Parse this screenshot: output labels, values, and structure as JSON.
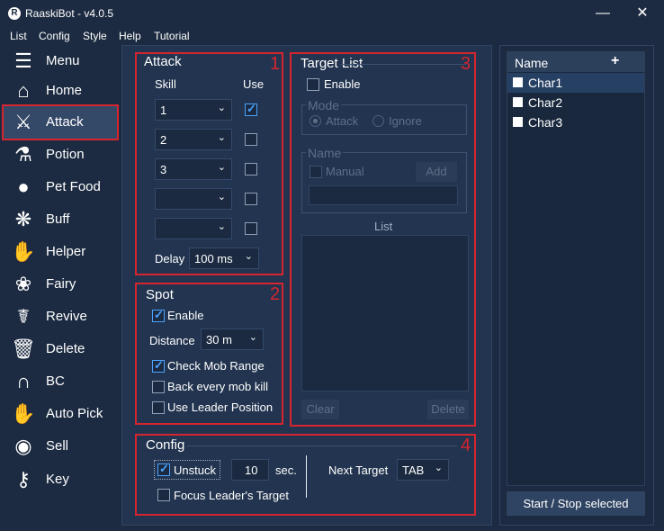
{
  "window": {
    "title": "RaaskiBot - v4.0.5",
    "minimize_icon": "minimize-icon",
    "close_icon": "close-icon"
  },
  "menu": [
    "List",
    "Config",
    "Style",
    "Help",
    "Tutorial"
  ],
  "sidebar": [
    {
      "label": "Menu",
      "icon": "hamburger-icon"
    },
    {
      "label": "Home",
      "icon": "home-icon"
    },
    {
      "label": "Attack",
      "icon": "sword-icon"
    },
    {
      "label": "Potion",
      "icon": "potion-icon"
    },
    {
      "label": "Pet Food",
      "icon": "pet-food-icon"
    },
    {
      "label": "Buff",
      "icon": "buff-icon"
    },
    {
      "label": "Helper",
      "icon": "handshake-icon"
    },
    {
      "label": "Fairy",
      "icon": "fairy-icon"
    },
    {
      "label": "Revive",
      "icon": "revive-icon"
    },
    {
      "label": "Delete",
      "icon": "trash-icon"
    },
    {
      "label": "BC",
      "icon": "bc-icon"
    },
    {
      "label": "Auto Pick",
      "icon": "auto-pick-icon"
    },
    {
      "label": "Sell",
      "icon": "coins-icon"
    },
    {
      "label": "Key",
      "icon": "key-icon"
    }
  ],
  "attack": {
    "title": "Attack",
    "number": "1",
    "skill_header": "Skill",
    "use_header": "Use",
    "rows": [
      {
        "skill": "1",
        "use": true
      },
      {
        "skill": "2",
        "use": false
      },
      {
        "skill": "3",
        "use": false
      },
      {
        "skill": "",
        "use": false
      },
      {
        "skill": "",
        "use": false
      }
    ],
    "delay_label": "Delay",
    "delay_value": "100 ms"
  },
  "spot": {
    "title": "Spot",
    "number": "2",
    "enable_label": "Enable",
    "enable": true,
    "distance_label": "Distance",
    "distance_value": "30 m",
    "check_mob_range_label": "Check Mob Range",
    "check_mob_range": true,
    "back_every_mob_kill_label": "Back every mob kill",
    "back_every_mob_kill": false,
    "use_leader_position_label": "Use Leader Position",
    "use_leader_position": false
  },
  "target_list": {
    "title": "Target List",
    "number": "3",
    "enable_label": "Enable",
    "enable": false,
    "mode_title": "Mode",
    "mode_attack": "Attack",
    "mode_ignore": "Ignore",
    "mode_selected": "Attack",
    "name_title": "Name",
    "manual_label": "Manual",
    "add_label": "Add",
    "name_value": "",
    "list_label": "List",
    "clear_label": "Clear",
    "delete_label": "Delete"
  },
  "config": {
    "title": "Config",
    "number": "4",
    "unstuck_label": "Unstuck",
    "unstuck": true,
    "unstuck_value": "10",
    "sec_label": "sec.",
    "next_target_label": "Next Target",
    "next_target_value": "TAB",
    "focus_leader_label": "Focus Leader's Target",
    "focus_leader": false
  },
  "characters": {
    "header": "Name",
    "add_label": "+",
    "items": [
      {
        "name": "Char1",
        "checked": false,
        "selected": true
      },
      {
        "name": "Char2",
        "checked": false,
        "selected": false
      },
      {
        "name": "Char3",
        "checked": false,
        "selected": false
      }
    ],
    "start_stop_label": "Start / Stop selected"
  },
  "colors": {
    "background": "#1c2b41",
    "panel": "#22344f",
    "highlight": "#d5252e",
    "accent": "#4aa3ff",
    "selected": "#344867"
  }
}
